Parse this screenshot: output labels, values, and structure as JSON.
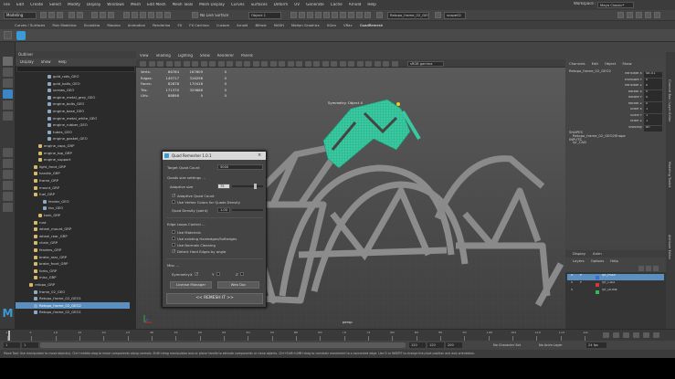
{
  "menubar": {
    "items": [
      "File",
      "Edit",
      "Create",
      "Select",
      "Modify",
      "Display",
      "Windows",
      "Mesh",
      "Edit Mesh",
      "Mesh Tools",
      "Mesh Display",
      "Curves",
      "Surfaces",
      "Deform",
      "UV",
      "Generate",
      "Cache",
      "Arnold",
      "Help"
    ],
    "workspace_label": "Workspace :",
    "workspace_value": "Maya Classic*"
  },
  "statusline": {
    "mode": "Modeling",
    "no_live_surface": "No Live Surface",
    "object_field": "Object 1",
    "name_field": "Retopo_frame_02_GEO2",
    "scope_field": "scope02"
  },
  "shelf_tabs": [
    "Curves / Surfaces",
    "Poly Modeling",
    "Sculpting",
    "Rigging",
    "Animation",
    "Rendering",
    "FX",
    "FX Caching",
    "Custom",
    "Arnold",
    "Bifrost",
    "MASH",
    "Motion Graphics",
    "XGen",
    "VRay",
    "QuadRemesh"
  ],
  "shelf_active": "QuadRemesh",
  "outliner": {
    "title": "Outliner",
    "menu": [
      "Display",
      "Show",
      "Help"
    ],
    "rows": [
      {
        "label": "gold_rods_GEO",
        "indent": 3,
        "color": "#8fa7c2"
      },
      {
        "label": "gold_bolts_GEO",
        "indent": 3,
        "color": "#8fa7c2"
      },
      {
        "label": "screws_GEO",
        "indent": 3,
        "color": "#8fa7c2"
      },
      {
        "label": "engine_metal_grey_GEO",
        "indent": 3,
        "color": "#8fa7c2"
      },
      {
        "label": "engine_bolts_GEO",
        "indent": 3,
        "color": "#8fa7c2"
      },
      {
        "label": "engine_base_GEO",
        "indent": 3,
        "color": "#8fa7c2"
      },
      {
        "label": "engine_metal_white_GEO",
        "indent": 3,
        "color": "#8fa7c2"
      },
      {
        "label": "engine_rubber_GEO",
        "indent": 3,
        "color": "#8fa7c2"
      },
      {
        "label": "tubes_GEO",
        "indent": 3,
        "color": "#8fa7c2"
      },
      {
        "label": "engine_gasket_GEO",
        "indent": 3,
        "color": "#8fa7c2"
      },
      {
        "label": "engine_caps_GRP",
        "indent": 1,
        "color": "#d8b86a"
      },
      {
        "label": "engine_top_GRP",
        "indent": 1,
        "color": "#d8b86a"
      },
      {
        "label": "engine_support",
        "indent": 1,
        "color": "#d8b86a"
      },
      {
        "label": "light_front_GRP",
        "indent": 0,
        "color": "#d8b86a"
      },
      {
        "label": "handle_GRP",
        "indent": 0,
        "color": "#d8b86a"
      },
      {
        "label": "frame_GRP",
        "indent": 0,
        "color": "#d8b86a"
      },
      {
        "label": "mount_GRP",
        "indent": 0,
        "color": "#d8b86a"
      },
      {
        "label": "fuel_GRP",
        "indent": 0,
        "color": "#d8b86a"
      },
      {
        "label": "fender_GEO",
        "indent": 2,
        "color": "#8fa7c2"
      },
      {
        "label": "fan_GEO",
        "indent": 2,
        "color": "#8fa7c2"
      },
      {
        "label": "tank_GRP",
        "indent": 1,
        "color": "#d8b86a"
      },
      {
        "label": "rust",
        "indent": 0,
        "color": "#d8b86a"
      },
      {
        "label": "wheel_mount_GRP",
        "indent": 0,
        "color": "#d8b86a"
      },
      {
        "label": "wheel_rear_GRP",
        "indent": 0,
        "color": "#d8b86a"
      },
      {
        "label": "chain_GRP",
        "indent": 0,
        "color": "#d8b86a"
      },
      {
        "label": "fenders_GRP",
        "indent": 0,
        "color": "#d8b86a"
      },
      {
        "label": "brake_rear_GRP",
        "indent": 0,
        "color": "#d8b86a"
      },
      {
        "label": "brake_front_GRP",
        "indent": 0,
        "color": "#d8b86a"
      },
      {
        "label": "forks_GRP",
        "indent": 0,
        "color": "#d8b86a"
      },
      {
        "label": "misc_GRP",
        "indent": 0,
        "color": "#d8b86a"
      },
      {
        "label": "retopo_GRP",
        "indent": -1,
        "color": "#d8b86a"
      },
      {
        "label": "frame_02_GEO",
        "indent": 0,
        "color": "#8fa7c2"
      },
      {
        "label": "Retopo_frame_02_GEO1",
        "indent": 0,
        "color": "#8fa7c2"
      },
      {
        "label": "Retopo_frame_02_GEO2",
        "indent": 0,
        "color": "#8fa7c2",
        "selected": true
      },
      {
        "label": "Retopo_frame_02_GEO1",
        "indent": 0,
        "color": "#8fa7c2"
      }
    ]
  },
  "viewport": {
    "menu": [
      "View",
      "Shading",
      "Lighting",
      "Show",
      "Renderer",
      "Panels"
    ],
    "color_space": "sRGB gamma",
    "hud": [
      {
        "label": "Verts:",
        "a": "66784",
        "b": "167609",
        "c": "0"
      },
      {
        "label": "Edges:",
        "a": "149717",
        "b": "316298",
        "c": "0"
      },
      {
        "label": "Faces:",
        "a": "82878",
        "b": "170418",
        "c": "0"
      },
      {
        "label": "Tris:",
        "a": "171370",
        "b": "329888",
        "c": "0"
      },
      {
        "label": "UVs:",
        "a": "88898",
        "b": "0",
        "c": "0"
      }
    ],
    "symmetry_label": "Symmetry: Object X",
    "camera_label": "persp"
  },
  "quad_remesher": {
    "title": "Quad Remesher 1.0.1",
    "target_label": "Target Quad Count",
    "target_value": "5000",
    "quads_size_label": "Quads size settings ...",
    "adaptive_size_label": "Adaptive size",
    "adaptive_size_value": "75",
    "adaptive_quad_count_label": "Adaptive Quad Count",
    "use_vertex_colors_label": "Use Vertex Colors for Quads Density",
    "quad_density_label": "Quad Density (paint)",
    "quad_density_value": "1.00",
    "edge_loops_label": "Edge Loops Control ...",
    "use_materials_label": "Use Materials",
    "use_normals_label": "Use existing Hardedges/Softedges",
    "use_normals_cleaning_label": "Use Normals Cleaning",
    "detect_hard_edges_label": "Detect Hard Edges by angle",
    "misc_label": "Misc ...",
    "symmetry_label": "Symmetry :",
    "sym_x": "X",
    "sym_y": "Y",
    "sym_z": "Z",
    "license_btn": "License Manager",
    "webdoc_btn": "Web Doc",
    "remesh_btn": "<< REMESH IT >>"
  },
  "channel_box": {
    "tabs": [
      "Channel Box / Layer Editor"
    ],
    "menu": [
      "Channels",
      "Edit",
      "Object",
      "Show"
    ],
    "object_name": "Retopo_frame_02_GEO2",
    "attributes": [
      {
        "label": "Translate X",
        "value": "48.01"
      },
      {
        "label": "Translate Y",
        "value": "0"
      },
      {
        "label": "Translate Z",
        "value": "0"
      },
      {
        "label": "Rotate X",
        "value": "0"
      },
      {
        "label": "Rotate Y",
        "value": "0"
      },
      {
        "label": "Rotate Z",
        "value": "0"
      },
      {
        "label": "Scale X",
        "value": "1"
      },
      {
        "label": "Scale Y",
        "value": "1"
      },
      {
        "label": "Scale Z",
        "value": "1"
      },
      {
        "label": "Visibility",
        "value": "on"
      }
    ],
    "shapes_header": "SHAPES",
    "shape_name": "Retopo_frame_02_GEO2Shape",
    "inputs_header": "INPUTS",
    "input_name": "lyr_CAD"
  },
  "right_tabs": [
    "Channel Box / Layer Editor",
    "Modeling Toolkit",
    "Attribute Editor"
  ],
  "layer_editor": {
    "tabs": [
      "Display",
      "Anim"
    ],
    "menu": [
      "Layers",
      "Options",
      "Help"
    ],
    "layers": [
      {
        "name": "lyr_POLY",
        "color": "#3d6fd1",
        "vis": "V",
        "pb": "P",
        "selected": true
      },
      {
        "name": "lyr_CAD",
        "color": "#d23a3a",
        "vis": "V",
        "pb": "P",
        "selected": false
      },
      {
        "name": "lyr_DONE",
        "color": "#3bb35b",
        "vis": "V",
        "pb": "",
        "selected": false
      }
    ]
  },
  "timeline": {
    "ticks": [
      "1",
      "5",
      "10",
      "15",
      "20",
      "25",
      "30",
      "35",
      "40",
      "45",
      "50",
      "55",
      "60",
      "65",
      "70",
      "75",
      "80",
      "85",
      "90",
      "95",
      "100",
      "105",
      "110",
      "115",
      "120"
    ],
    "start_a": "1",
    "start_b": "1",
    "end_a": "120",
    "end_b": "120",
    "end_c": "200",
    "character_set": "No Character Set",
    "anim_layer": "No Anim Layer",
    "fps": "24 fps"
  },
  "help_line": "Move Tool: Use manipulator to move object(s). Ctrl+middle-drag to move components along normals. Shift+drag manipulator axis or plane handle to extrude components or clone objects. Ctrl+Shift+LMB+drag to constrain movement to a connected edge. Use D or INSERT to change the pivot position and axis orientation.",
  "colors": {
    "selection": "#5a8fbf",
    "retopo_mesh": "#39c9a0",
    "frame_mesh": "#8a8a8a"
  }
}
